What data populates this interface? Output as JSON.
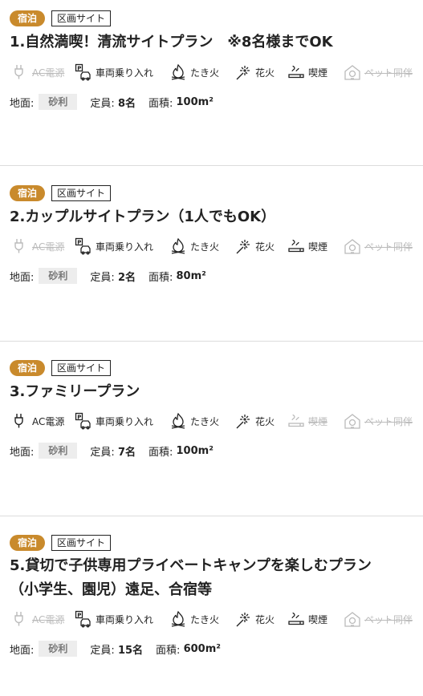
{
  "plans": [
    {
      "tag1": "宿泊",
      "tag2": "区画サイト",
      "title": "1.自然満喫！清流サイトプラン　※8名様までOK",
      "title2": "",
      "features": [
        {
          "icon": "plug-icon",
          "label": "AC電源",
          "on": false
        },
        {
          "icon": "car-parking-icon",
          "label": "車両乗り入れ",
          "on": true
        },
        {
          "icon": "campfire-icon",
          "label": "たき火",
          "on": true
        },
        {
          "icon": "fireworks-icon",
          "label": "花火",
          "on": true
        },
        {
          "icon": "smoking-icon",
          "label": "喫煙",
          "on": true
        },
        {
          "icon": "pet-house-icon",
          "label": "ペット同伴",
          "on": false
        }
      ],
      "ground_label": "地面:",
      "ground": "砂利",
      "capacity_label": "定員:",
      "capacity": "8名",
      "area_label": "面積:",
      "area": "100m²"
    },
    {
      "tag1": "宿泊",
      "tag2": "区画サイト",
      "title": "2.カップルサイトプラン（1人でもOK）",
      "title2": "",
      "features": [
        {
          "icon": "plug-icon",
          "label": "AC電源",
          "on": false
        },
        {
          "icon": "car-parking-icon",
          "label": "車両乗り入れ",
          "on": true
        },
        {
          "icon": "campfire-icon",
          "label": "たき火",
          "on": true
        },
        {
          "icon": "fireworks-icon",
          "label": "花火",
          "on": true
        },
        {
          "icon": "smoking-icon",
          "label": "喫煙",
          "on": true
        },
        {
          "icon": "pet-house-icon",
          "label": "ペット同伴",
          "on": false
        }
      ],
      "ground_label": "地面:",
      "ground": "砂利",
      "capacity_label": "定員:",
      "capacity": "2名",
      "area_label": "面積:",
      "area": "80m²"
    },
    {
      "tag1": "宿泊",
      "tag2": "区画サイト",
      "title": "3.ファミリープラン",
      "title2": "",
      "features": [
        {
          "icon": "plug-icon",
          "label": "AC電源",
          "on": true
        },
        {
          "icon": "car-parking-icon",
          "label": "車両乗り入れ",
          "on": true
        },
        {
          "icon": "campfire-icon",
          "label": "たき火",
          "on": true
        },
        {
          "icon": "fireworks-icon",
          "label": "花火",
          "on": true
        },
        {
          "icon": "smoking-icon",
          "label": "喫煙",
          "on": false
        },
        {
          "icon": "pet-house-icon",
          "label": "ペット同伴",
          "on": false
        }
      ],
      "ground_label": "地面:",
      "ground": "砂利",
      "capacity_label": "定員:",
      "capacity": "7名",
      "area_label": "面積:",
      "area": "100m²"
    },
    {
      "tag1": "宿泊",
      "tag2": "区画サイト",
      "title": "5.貸切で子供専用プライベートキャンプを楽しむプラン",
      "title2": "（小学生、園児）遠足、合宿等",
      "features": [
        {
          "icon": "plug-icon",
          "label": "AC電源",
          "on": false
        },
        {
          "icon": "car-parking-icon",
          "label": "車両乗り入れ",
          "on": true
        },
        {
          "icon": "campfire-icon",
          "label": "たき火",
          "on": true
        },
        {
          "icon": "fireworks-icon",
          "label": "花火",
          "on": true
        },
        {
          "icon": "smoking-icon",
          "label": "喫煙",
          "on": true
        },
        {
          "icon": "pet-house-icon",
          "label": "ペット同伴",
          "on": false
        }
      ],
      "ground_label": "地面:",
      "ground": "砂利",
      "capacity_label": "定員:",
      "capacity": "15名",
      "area_label": "面積:",
      "area": "600m²"
    }
  ],
  "colors": {
    "accent": "#c98a2c",
    "disabled": "#bbbbbb",
    "text": "#222222",
    "badge_bg": "#ededed"
  }
}
